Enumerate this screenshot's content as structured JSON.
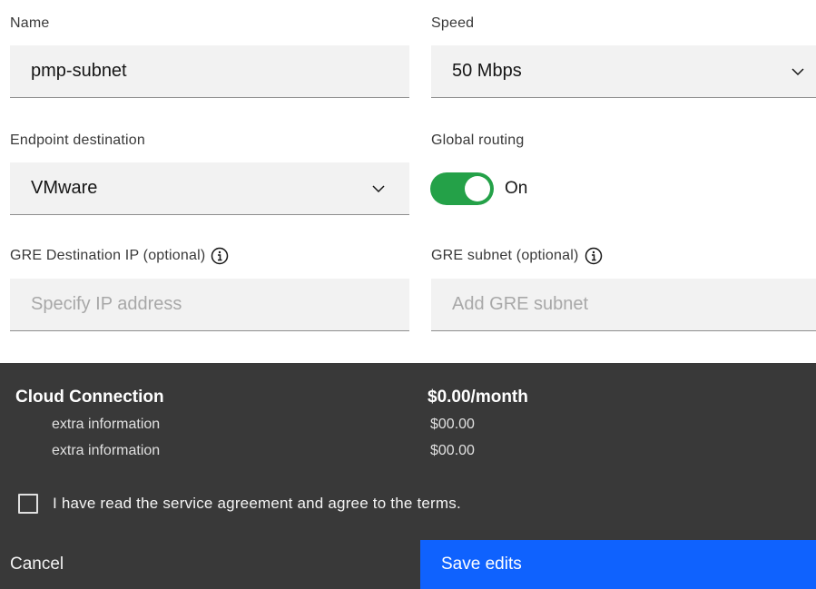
{
  "form": {
    "name": {
      "label": "Name",
      "value": "pmp-subnet"
    },
    "speed": {
      "label": "Speed",
      "value": "50 Mbps"
    },
    "endpoint": {
      "label": "Endpoint destination",
      "value": "VMware"
    },
    "global_routing": {
      "label": "Global routing",
      "state_label": "On",
      "enabled": true
    },
    "gre_destination_ip": {
      "label": "GRE Destination IP (optional)",
      "placeholder": "Specify IP address"
    },
    "gre_subnet": {
      "label": "GRE subnet (optional)",
      "placeholder": "Add GRE subnet"
    }
  },
  "summary": {
    "title": "Cloud Connection",
    "total": "$0.00/month",
    "lines": [
      {
        "label": "extra information",
        "value": "$00.00"
      },
      {
        "label": "extra information",
        "value": "$00.00"
      }
    ],
    "agreement_text": "I have read the service agreement and agree to the terms.",
    "agreement_checked": false
  },
  "actions": {
    "cancel_label": "Cancel",
    "save_label": "Save edits"
  },
  "colors": {
    "toggle_on": "#24a148",
    "primary_button": "#0f62fe",
    "summary_bg": "#393939",
    "field_bg": "#f2f2f2"
  },
  "icons": [
    "chevron-down-icon",
    "info-icon"
  ]
}
